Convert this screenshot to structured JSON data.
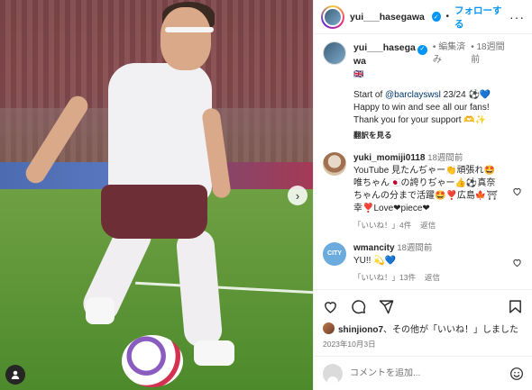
{
  "post": {
    "next_glyph": "›"
  },
  "header": {
    "username": "yui___hasegawa",
    "separator": "•",
    "follow_label": "フォローする",
    "more_glyph": "···"
  },
  "caption": {
    "username_line1": "yui___hasega",
    "username_line2": "wa",
    "edited": "編集済",
    "edited2": "み",
    "separator": "•",
    "time_line1": "18週間",
    "time_line2": "前",
    "flag": "🇬🇧",
    "text_before": "Start of ",
    "mention": "@barclayswsl",
    "text_after": " 23/24 ⚽️💙",
    "line2": "Happy to win and see all our fans!",
    "line3": "Thank you for your support 🫶✨",
    "translate_label": "翻訳を見る"
  },
  "comments": [
    {
      "user": "yuki_momiji0118",
      "time": "18週間前",
      "text": "YouTube 見たんぢゃー👏頑張れ🤩唯ちゃん🇯🇵の誇りぢゃー👍⚽️真奈ちゃんの分まで活躍🤩❣️広島🍁⛩幸❣️Love❤piece❤",
      "likes": "「いいね！」4件",
      "reply": "返信"
    },
    {
      "user": "wmancity",
      "time": "18週間前",
      "text": "YU!! 💫💙",
      "likes": "「いいね！」13件",
      "reply": "返信"
    }
  ],
  "footer": {
    "liked_by_user": "shinjiono7",
    "liked_by_text": "、その他が「いいね！」しました",
    "date": "2023年10月3日"
  },
  "add_comment": {
    "placeholder": "コメントを追加..."
  },
  "colors": {
    "accent": "#0095f6",
    "text": "#262626",
    "muted": "#737373"
  },
  "icons": [
    "verified-icon",
    "like-icon",
    "comment-icon",
    "share-icon",
    "save-icon",
    "emoji-icon",
    "tag-icon",
    "next-icon"
  ]
}
